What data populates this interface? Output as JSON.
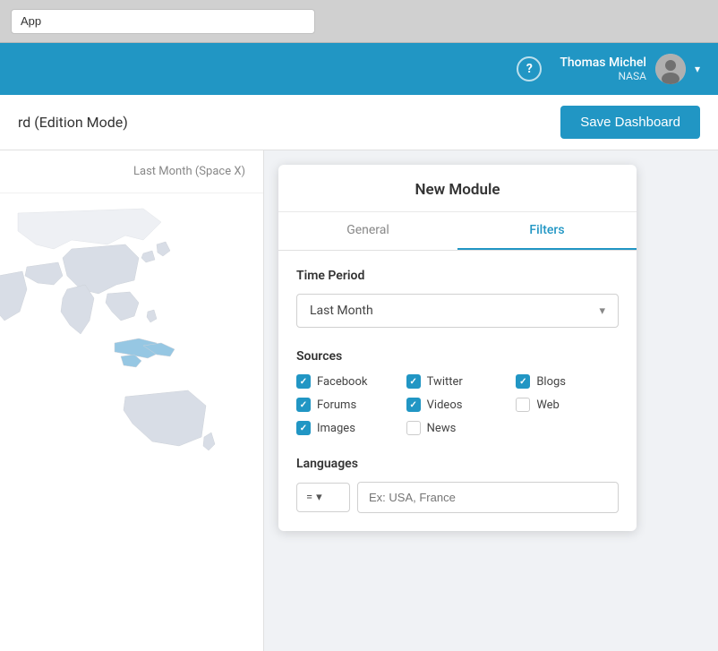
{
  "browser": {
    "url_value": "App"
  },
  "topnav": {
    "help_label": "?",
    "user_name": "Thomas Michel",
    "user_org": "NASA",
    "chevron": "▾"
  },
  "toolbar": {
    "title": "rd (Edition Mode)",
    "save_button": "Save Dashboard"
  },
  "left_panel": {
    "filter_label": "Last Month (Space X)"
  },
  "modal": {
    "title": "New Module",
    "tabs": [
      {
        "id": "general",
        "label": "General",
        "active": false
      },
      {
        "id": "filters",
        "label": "Filters",
        "active": true
      }
    ],
    "time_period": {
      "label": "Time Period",
      "selected": "Last Month"
    },
    "sources": {
      "label": "Sources",
      "items": [
        {
          "id": "facebook",
          "label": "Facebook",
          "checked": true
        },
        {
          "id": "twitter",
          "label": "Twitter",
          "checked": true
        },
        {
          "id": "blogs",
          "label": "Blogs",
          "checked": true
        },
        {
          "id": "forums",
          "label": "Forums",
          "checked": true
        },
        {
          "id": "videos",
          "label": "Videos",
          "checked": true
        },
        {
          "id": "web",
          "label": "Web",
          "checked": false
        },
        {
          "id": "images",
          "label": "Images",
          "checked": true
        },
        {
          "id": "news",
          "label": "News",
          "checked": false
        }
      ]
    },
    "languages": {
      "label": "Languages",
      "operator": "=",
      "placeholder": "Ex: USA, France"
    }
  }
}
